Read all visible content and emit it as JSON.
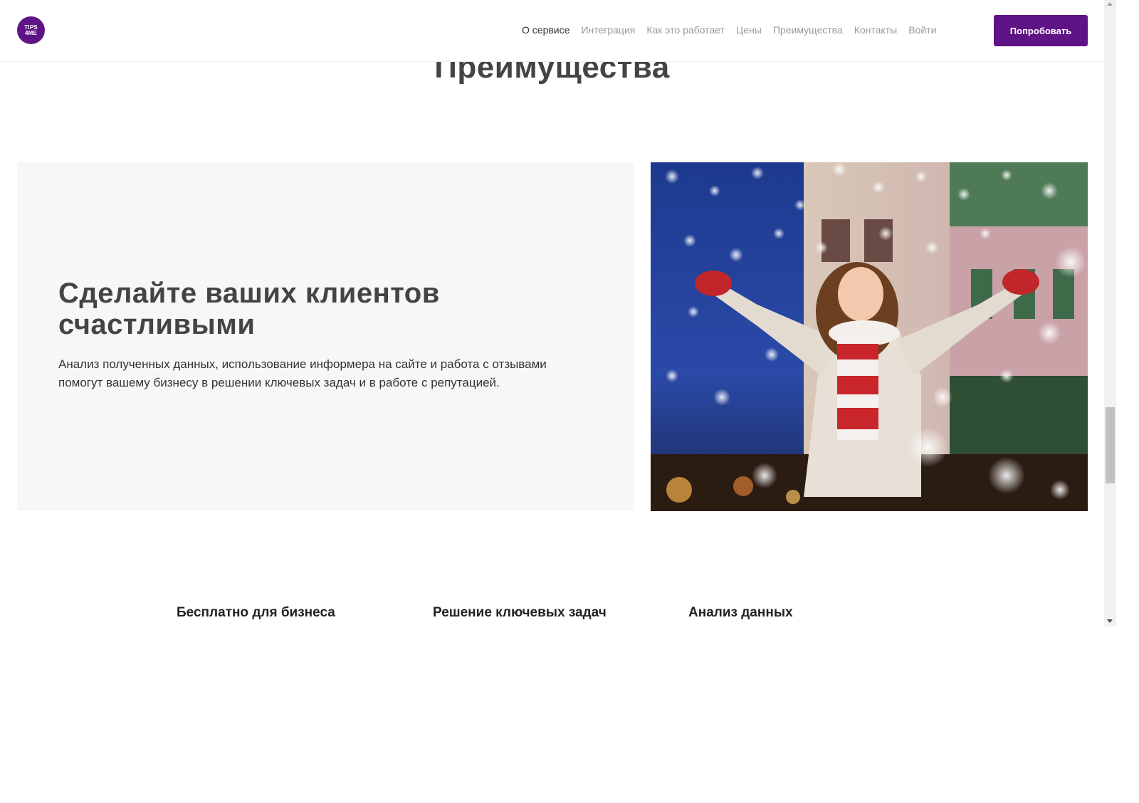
{
  "header": {
    "logo_line1": "TIPS",
    "logo_line2": "4ME",
    "nav": [
      {
        "label": "О сервисе",
        "active": true
      },
      {
        "label": "Интеграция",
        "active": false
      },
      {
        "label": "Как это работает",
        "active": false
      },
      {
        "label": "Цены",
        "active": false
      },
      {
        "label": "Преимущества",
        "active": false
      },
      {
        "label": "Контакты",
        "active": false
      },
      {
        "label": "Войти",
        "active": false
      }
    ],
    "cta_label": "Попробовать"
  },
  "section": {
    "title": "Преимущества"
  },
  "promo": {
    "heading": "Сделайте ваших клиентов счастливыми",
    "text": "Анализ полученных данных, использование информера на сайте и работа с отзывами помогут вашему бизнесу в решении ключевых задач и в работе с репутацией."
  },
  "features": [
    {
      "title": "Бесплатно для бизнеса"
    },
    {
      "title": "Решение ключевых задач"
    },
    {
      "title": "Анализ данных"
    }
  ],
  "colors": {
    "brand": "#5f1486",
    "card_bg": "#f7f7f7",
    "text_dark": "#444444",
    "nav_inactive": "#999999"
  }
}
